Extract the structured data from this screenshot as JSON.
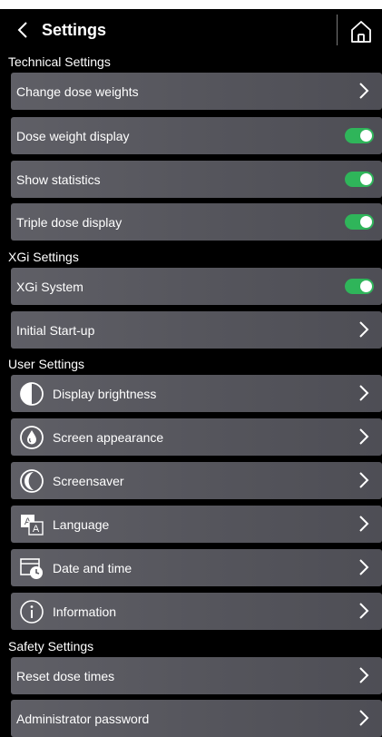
{
  "header": {
    "title": "Settings"
  },
  "colors": {
    "accent_toggle": "#2fb55a",
    "row_bg": "#5a5a61",
    "background": "#000000"
  },
  "sections": {
    "technical": {
      "title": "Technical Settings",
      "items": [
        {
          "label": "Change dose weights",
          "control": "chevron"
        },
        {
          "label": "Dose weight display",
          "control": "toggle",
          "on": true
        },
        {
          "label": "Show statistics",
          "control": "toggle",
          "on": true
        },
        {
          "label": "Triple dose display",
          "control": "toggle",
          "on": true
        }
      ]
    },
    "xgi": {
      "title": "XGi Settings",
      "items": [
        {
          "label": "XGi System",
          "control": "toggle",
          "on": true
        },
        {
          "label": "Initial Start-up",
          "control": "chevron"
        }
      ]
    },
    "user": {
      "title": "User Settings",
      "items": [
        {
          "label": "Display brightness",
          "icon": "brightness-icon",
          "control": "chevron"
        },
        {
          "label": "Screen appearance",
          "icon": "drop-icon",
          "control": "chevron"
        },
        {
          "label": "Screensaver",
          "icon": "moon-icon",
          "control": "chevron"
        },
        {
          "label": "Language",
          "icon": "language-icon",
          "control": "chevron"
        },
        {
          "label": "Date and time",
          "icon": "calendar-clock-icon",
          "control": "chevron"
        },
        {
          "label": "Information",
          "icon": "info-icon",
          "control": "chevron"
        }
      ]
    },
    "safety": {
      "title": "Safety Settings",
      "items": [
        {
          "label": "Reset dose times",
          "control": "chevron"
        },
        {
          "label": "Administrator password",
          "control": "chevron"
        }
      ]
    }
  }
}
